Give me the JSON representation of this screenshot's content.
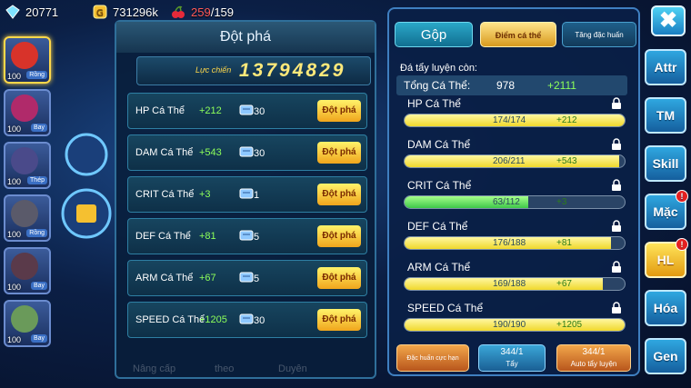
{
  "topbar": {
    "diamonds": "20771",
    "gold": "731296k",
    "hearts_current": "259",
    "hearts_max": "/159"
  },
  "characters": [
    {
      "level": "100",
      "tag": "Rồng",
      "tag2": "Đánh",
      "color": "#d8332a"
    },
    {
      "level": "100",
      "tag": "Bay",
      "tag2": "",
      "color": "#b02a6a"
    },
    {
      "level": "100",
      "tag": "Thép",
      "tag2": "Bay",
      "color": "#4a4a8a"
    },
    {
      "level": "100",
      "tag": "Rồng",
      "tag2": "Nước",
      "color": "#5a5a6a"
    },
    {
      "level": "100",
      "tag": "Bay",
      "tag2": "Ác",
      "color": "#5a3a4a"
    },
    {
      "level": "100",
      "tag": "Bay",
      "tag2": "",
      "color": "#6a9a5a"
    }
  ],
  "breakthrough": {
    "title": "Đột phá",
    "power_label": "Lực chiến",
    "power_value": "13794829",
    "rows": [
      {
        "name": "HP Cá Thể",
        "bonus": "+212",
        "count": "30",
        "button": "Đột phá"
      },
      {
        "name": "DAM Cá Thể",
        "bonus": "+543",
        "count": "30",
        "button": "Đột phá"
      },
      {
        "name": "CRIT Cá Thể",
        "bonus": "+3",
        "count": "1",
        "button": "Đột phá"
      },
      {
        "name": "DEF Cá Thể",
        "bonus": "+81",
        "count": "5",
        "button": "Đột phá"
      },
      {
        "name": "ARM Cá Thể",
        "bonus": "+67",
        "count": "5",
        "button": "Đột phá"
      },
      {
        "name": "SPEED Cá Thể",
        "bonus": "+1205",
        "count": "30",
        "button": "Đột phá"
      }
    ],
    "bottom_tabs": [
      "Nâng cấp",
      "theo",
      "Duyên"
    ]
  },
  "stats_panel": {
    "tabs": {
      "gop": "Gộp",
      "diem": "Điểm cá thể",
      "tang": "Tăng đặc huấn"
    },
    "remaining_label": "Đá tẩy luyện còn:",
    "total_label": "Tổng Cá Thể:",
    "total_value": "978",
    "total_bonus": "+2111",
    "stats": [
      {
        "name": "HP Cá Thể",
        "value": "174/174",
        "bonus": "+212",
        "fill": 1.0,
        "kind": "y"
      },
      {
        "name": "DAM Cá Thể",
        "value": "206/211",
        "bonus": "+543",
        "fill": 0.976,
        "kind": "y"
      },
      {
        "name": "CRIT Cá Thể",
        "value": "63/112",
        "bonus": "+3",
        "fill": 0.5625,
        "kind": "g"
      },
      {
        "name": "DEF Cá Thể",
        "value": "176/188",
        "bonus": "+81",
        "fill": 0.936,
        "kind": "y"
      },
      {
        "name": "ARM Cá Thể",
        "value": "169/188",
        "bonus": "+67",
        "fill": 0.899,
        "kind": "y"
      },
      {
        "name": "SPEED Cá Thể",
        "value": "190/190",
        "bonus": "+1205",
        "fill": 1.0,
        "kind": "y"
      }
    ],
    "actions": {
      "dac_huan": "Đặc huấn cực hạn",
      "tay_count": "344/1",
      "tay_label": "Tẩy",
      "auto_count": "344/1",
      "auto_label": "Auto tẩy luyện"
    }
  },
  "side_tabs": [
    {
      "label": "Attr",
      "badge": false
    },
    {
      "label": "TM",
      "badge": false
    },
    {
      "label": "Skill",
      "badge": false
    },
    {
      "label": "Mặc",
      "badge": true
    },
    {
      "label": "HL",
      "badge": true,
      "active": true
    },
    {
      "label": "Hóa",
      "badge": false
    },
    {
      "label": "Gen",
      "badge": false
    }
  ],
  "close_icon": "✖"
}
